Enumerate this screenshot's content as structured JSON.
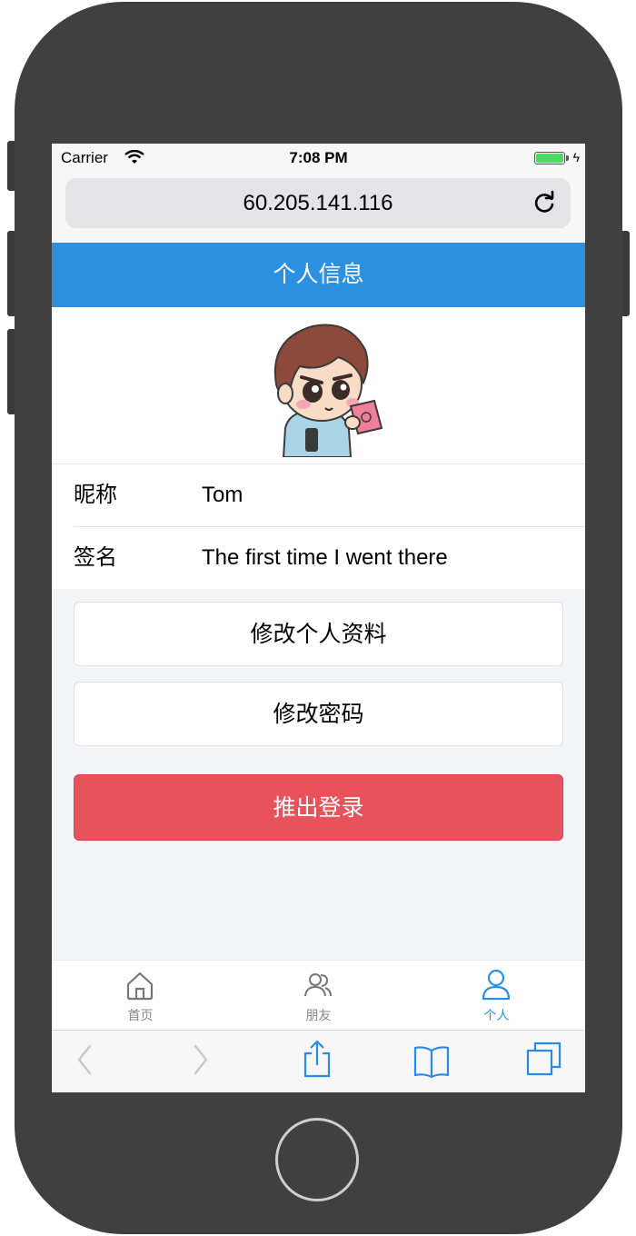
{
  "statusbar": {
    "carrier": "Carrier",
    "time": "7:08 PM"
  },
  "browser": {
    "url": "60.205.141.116"
  },
  "header": {
    "title": "个人信息"
  },
  "profile": {
    "rows": [
      {
        "label": "昵称",
        "value": "Tom"
      },
      {
        "label": "签名",
        "value": "The first time I went there"
      }
    ]
  },
  "actions": {
    "edit_profile": "修改个人资料",
    "change_password": "修改密码",
    "logout": "推出登录"
  },
  "tabs": [
    {
      "label": "首页",
      "icon": "home-icon",
      "active": false
    },
    {
      "label": "朋友",
      "icon": "friends-icon",
      "active": false
    },
    {
      "label": "个人",
      "icon": "person-icon",
      "active": true
    }
  ],
  "colors": {
    "header": "#2b90e0",
    "logout": "#e8525b",
    "active_tab": "#2b90e0"
  }
}
